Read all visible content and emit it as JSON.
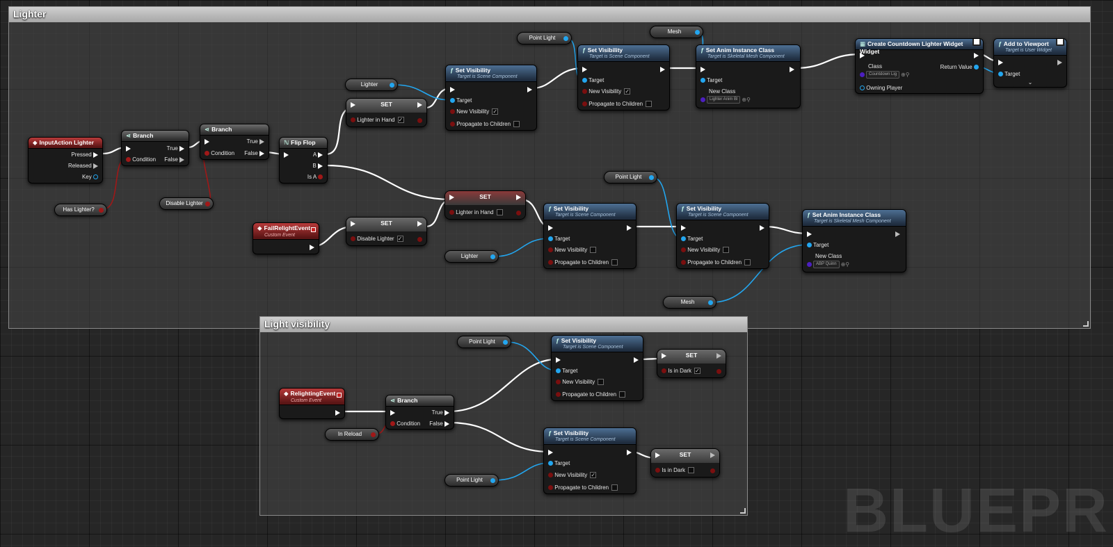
{
  "comments": {
    "lighter": "Lighter",
    "light_visibility": "Light visibility"
  },
  "watermark": "BLUEPRI",
  "input_action": {
    "title": "InputAction Lighter",
    "pressed": "Pressed",
    "released": "Released",
    "key": "Key"
  },
  "branch1": {
    "title": "Branch",
    "condition": "Condition",
    "true_label": "True",
    "false_label": "False"
  },
  "branch2": {
    "title": "Branch",
    "condition": "Condition",
    "true_label": "True",
    "false_label": "False"
  },
  "flipflop": {
    "title": "Flip Flop",
    "a": "A",
    "b": "B",
    "is_a": "Is A"
  },
  "var_has_lighter": "Has Lighter?",
  "var_disable_lighter": "Disable Lighter",
  "var_lighter_top": "Lighter",
  "var_point_light_top": "Point Light",
  "var_mesh_top": "Mesh",
  "var_point_light_mid": "Point Light",
  "var_lighter_mid": "Lighter",
  "var_mesh_bottom": "Mesh",
  "var_point_light_lv1": "Point Light",
  "var_in_reload": "In Reload",
  "var_point_light_lv2": "Point Light",
  "set_lighter_top": {
    "title": "SET",
    "label": "Lighter in Hand",
    "checked": true
  },
  "set_lighter_mid": {
    "title": "SET",
    "label": "Lighter in Hand",
    "checked": false
  },
  "set_disable": {
    "title": "SET",
    "label": "Disable Lighter",
    "checked": true
  },
  "set_dark1": {
    "title": "SET",
    "label": "Is in Dark",
    "checked": true
  },
  "set_dark2": {
    "title": "SET",
    "label": "Is in Dark",
    "checked": false
  },
  "sv1": {
    "title": "Set Visibility",
    "sub": "Target is Scene Component",
    "target": "Target",
    "new_vis": "New Visibility",
    "propagate": "Propagate to Children",
    "vis": true
  },
  "sv2": {
    "title": "Set Visibility",
    "sub": "Target is Scene Component",
    "target": "Target",
    "new_vis": "New Visibility",
    "propagate": "Propagate to Children",
    "vis": true
  },
  "sv3": {
    "title": "Set Visibility",
    "sub": "Target is Scene Component",
    "target": "Target",
    "new_vis": "New Visibility",
    "propagate": "Propagate to Children",
    "vis": false
  },
  "sv4": {
    "title": "Set Visibility",
    "sub": "Target is Scene Component",
    "target": "Target",
    "new_vis": "New Visibility",
    "propagate": "Propagate to Children",
    "vis": false
  },
  "sv5": {
    "title": "Set Visibility",
    "sub": "Target is Scene Component",
    "target": "Target",
    "new_vis": "New Visibility",
    "propagate": "Propagate to Children",
    "vis": false
  },
  "sv6": {
    "title": "Set Visibility",
    "sub": "Target is Scene Component",
    "target": "Target",
    "new_vis": "New Visibility",
    "propagate": "Propagate to Children",
    "vis": true
  },
  "anim1": {
    "title": "Set Anim Instance Class",
    "sub": "Target is Skeletal Mesh Component",
    "target": "Target",
    "new_class": "New Class",
    "class_value": "Lighter Anim Bl"
  },
  "anim2": {
    "title": "Set Anim Instance Class",
    "sub": "Target is Skeletal Mesh Component",
    "target": "Target",
    "new_class": "New Class",
    "class_value": "ABP Quinn"
  },
  "create_widget": {
    "title": "Create Countdown Lighter Widget Widget",
    "class": "Class",
    "class_value": "Countdown Lig",
    "return_value": "Return Value",
    "owning_player": "Owning Player"
  },
  "add_viewport": {
    "title": "Add to Viewport",
    "sub": "Target is User Widget",
    "target": "Target"
  },
  "fail_event": {
    "title": "FailRelightEvent",
    "sub": "Custom Event"
  },
  "relight_event": {
    "title": "RelightingEvent",
    "sub": "Custom Event"
  },
  "branch3": {
    "title": "Branch",
    "condition": "Condition",
    "true_label": "True",
    "false_label": "False"
  },
  "colors": {
    "exec": "#ffffff",
    "object": "#23a6ef",
    "bool": "#a01818",
    "class": "#4c1fbf",
    "event": "#b83a3a"
  }
}
